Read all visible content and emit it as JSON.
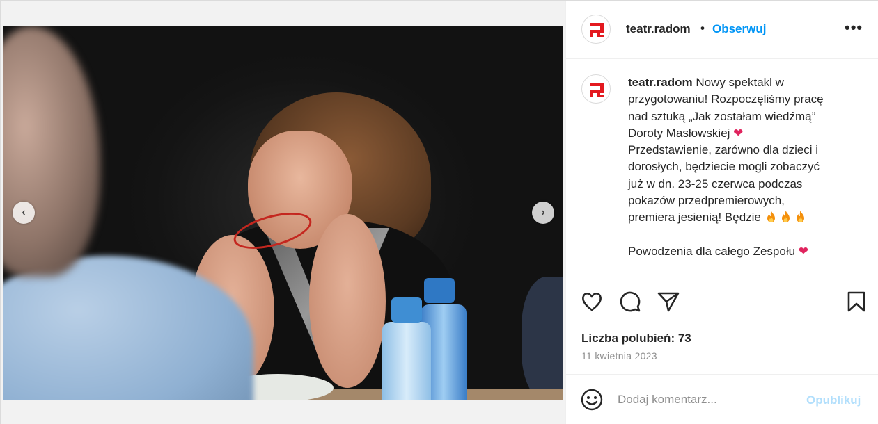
{
  "post": {
    "username": "teatr.radom",
    "separator": "•",
    "follow_label": "Obserwuj",
    "more_label": "•••"
  },
  "caption": {
    "username": "teatr.radom",
    "lines": [
      "Nowy spektakl w",
      "przygotowaniu! Rozpoczęliśmy pracę",
      "nad sztuką „Jak zostałam wiedźmą”",
      "Doroty Masłowskiej",
      "Przedstawienie, zarówno dla dzieci i",
      "dorosłych, będziecie mogli zobaczyć",
      "już w dn. 23-25 czerwca podczas",
      "pokazów przedpremierowych,",
      "premiera jesienią! Będzie",
      "Powodzenia dla całego Zespołu"
    ],
    "heart": "❤"
  },
  "stats": {
    "likes": "Liczba polubień: 73",
    "date": "11 kwietnia 2023"
  },
  "comment": {
    "placeholder": "Dodaj komentarz...",
    "publish_label": "Opublikuj"
  },
  "carousel": {
    "prev": "‹",
    "next": "›",
    "slide_count": 3,
    "active_slide": 1
  },
  "icons": {
    "avatar": "red-pixel-logo-icon",
    "like": "heart-outline-icon",
    "comment": "speech-bubble-icon",
    "share": "paper-plane-icon",
    "save": "bookmark-icon",
    "emoji": "smiley-icon",
    "fire": "fire-emoji-icon"
  },
  "colors": {
    "accent": "#0095f6",
    "publish_disabled": "#b2dffc",
    "brand_red": "#e3191f"
  }
}
